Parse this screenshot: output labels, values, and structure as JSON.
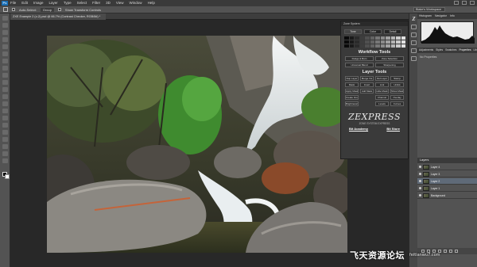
{
  "app": {
    "logo": "Ps"
  },
  "menu": [
    "File",
    "Edit",
    "Image",
    "Layer",
    "Type",
    "Select",
    "Filter",
    "3D",
    "View",
    "Window",
    "Help"
  ],
  "options_bar": {
    "auto_select_label": "Auto-Select:",
    "auto_select_value": "Group",
    "show_transform_label": "Show Transform Controls",
    "workspace": "Blake's Workspace"
  },
  "document": {
    "tab_title": "ZXE Example 2 (v-2).psd @ 66.7% (Contrast Checker, RGB/8#) *"
  },
  "zone_panel": {
    "header": "Zone System",
    "tabs": [
      {
        "label": "Tone",
        "active": true
      },
      {
        "label": "Color",
        "active": false
      },
      {
        "label": "Detail",
        "active": false
      }
    ],
    "gray_rows": [
      [
        "#0a0a0a",
        "#1a1a1a",
        "#2b2b2b",
        "#3d3d3d",
        "#505050",
        "#636363",
        "#777777",
        "#8b8b8b",
        "#a0a0a0",
        "#b5b5b5",
        "#cacaca",
        "#e0e0e0"
      ],
      [
        "#0a0a0a",
        "#1a1a1a",
        "#2b2b2b",
        "#3d3d3d",
        "#505050",
        "#636363",
        "#777777",
        "#8b8b8b",
        "#a0a0a0",
        "#b5b5b5",
        "#cacaca",
        "#e0e0e0"
      ],
      [
        "#0a0a0a",
        "#1a1a1a",
        "#2b2b2b",
        "#3d3d3d",
        "#505050",
        "#636363",
        "#777777",
        "#8b8b8b",
        "#a0a0a0",
        "#b5b5b5",
        "#cacaca",
        "#e0e0e0"
      ]
    ],
    "workflow_title": "Workflow Tools",
    "workflow_buttons": [
      [
        "Dodge & Burn",
        "Zone Selection"
      ],
      [
        "Universal Blend",
        "Sharpening"
      ]
    ],
    "layer_title": "Layer Tools",
    "layer_buttons": [
      [
        "Dup Layer",
        "Merge Vis",
        "Del Layer",
        "Stamp"
      ],
      [
        "Mask",
        "Invert",
        "Link",
        "Unlink"
      ],
      [
        "Apply Mask",
        "Add Mask",
        "Hide Mask",
        "Show Mask"
      ],
      [
        "Create Group",
        "",
        "Channel",
        "Overlay"
      ],
      [
        "Brightness/Contrast",
        "",
        "Levels",
        "Curves"
      ]
    ],
    "logo_text": "ZEXPRESS",
    "logo_sub": "ZONE SYSTEM EXPRESS",
    "links": [
      "Bit Academy",
      "Bit Store"
    ]
  },
  "right_panel": {
    "hist_tabs": [
      "Histogram",
      "Navigator",
      "Info"
    ],
    "prop_tabs": [
      "Adjustments",
      "Styles",
      "Swatches",
      "Properties",
      "Libraries"
    ],
    "props_title": "No Properties",
    "layers_header": "Layers",
    "layers": [
      {
        "name": "Layer 4",
        "selected": false
      },
      {
        "name": "Layer 3",
        "selected": false
      },
      {
        "name": "Layer 2",
        "selected": true
      },
      {
        "name": "Layer 1",
        "selected": false
      },
      {
        "name": "Background",
        "selected": false
      }
    ]
  },
  "watermark": {
    "cn": "飞天资源论坛",
    "url": "feitianwu7.com"
  }
}
